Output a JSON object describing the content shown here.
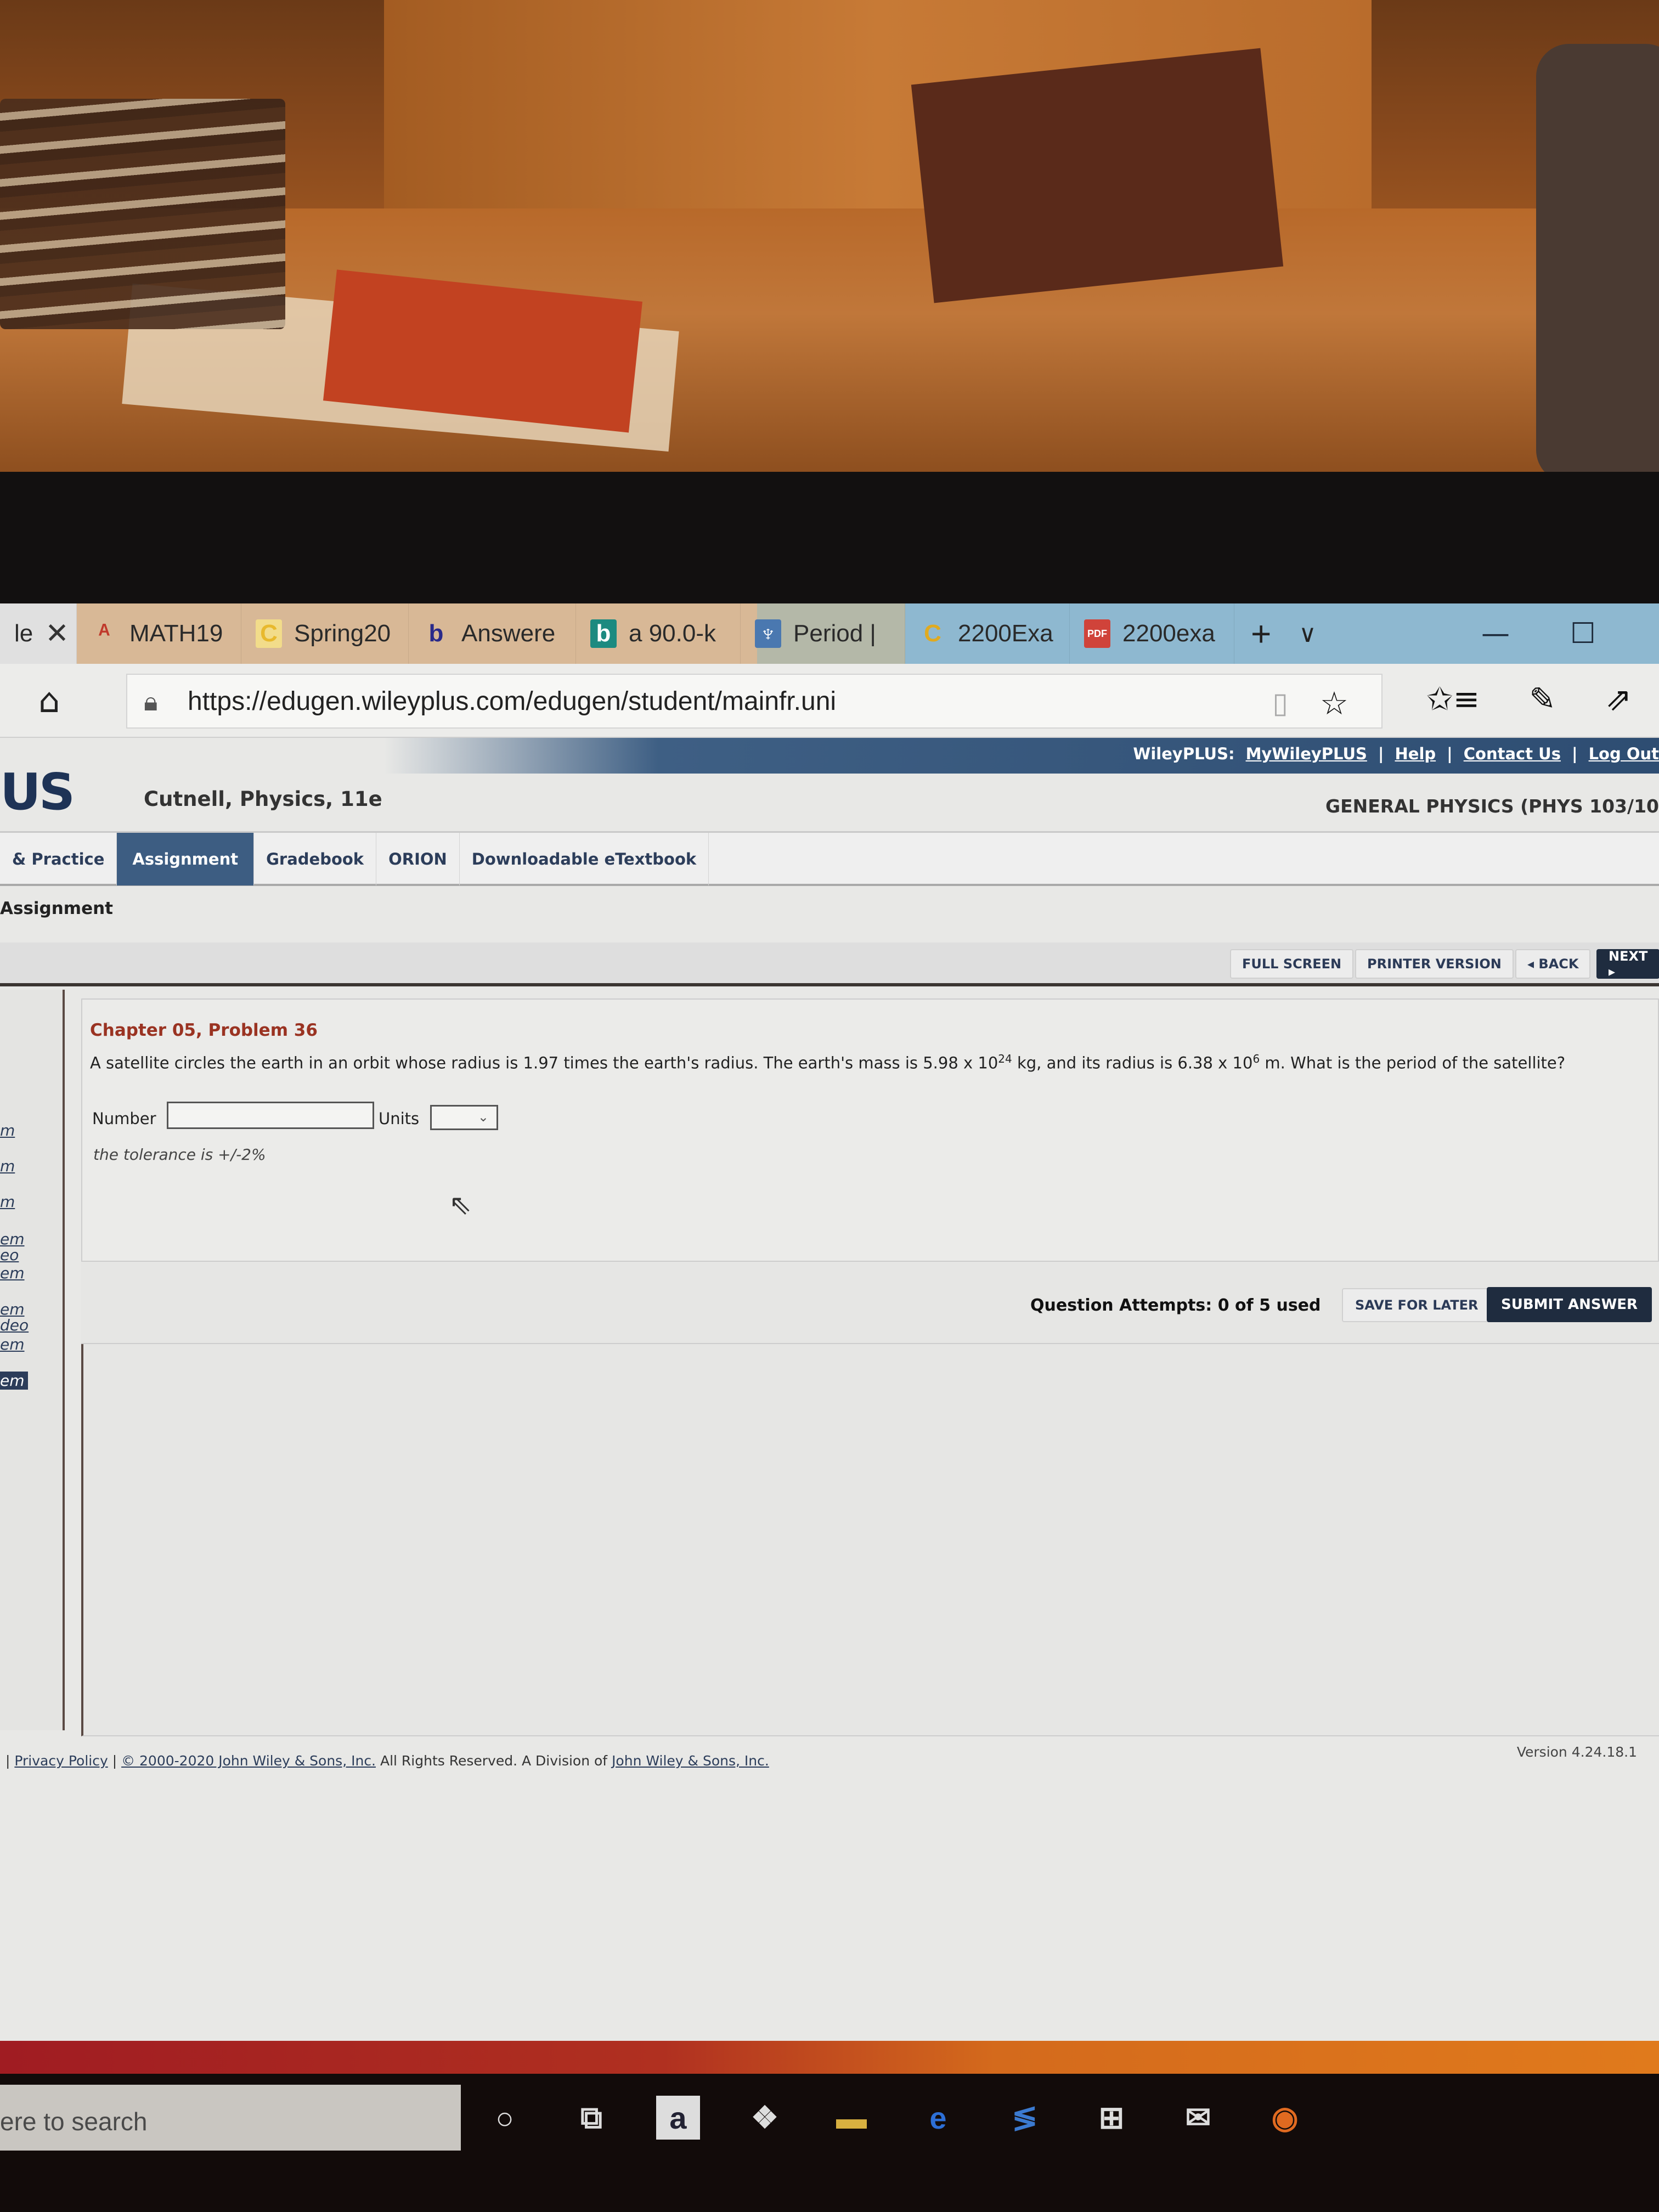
{
  "browser": {
    "tabs": [
      {
        "label": "le",
        "icon": "close-icon",
        "partial": true
      },
      {
        "label": "MATH19",
        "icon": "webassign-icon"
      },
      {
        "label": "Spring20",
        "icon": "c-logo-icon"
      },
      {
        "label": "Answere",
        "icon": "b-logo-icon"
      },
      {
        "label": "a 90.0-k",
        "icon": "bing-icon"
      },
      {
        "label": "Period |",
        "icon": "thistle-icon"
      },
      {
        "label": "2200Exa",
        "icon": "c-logo-icon"
      },
      {
        "label": "2200exa",
        "icon": "pdf-icon"
      }
    ],
    "new_tab": "+",
    "tab_list": "∨",
    "minimize": "—",
    "maximize": "☐",
    "url": "https://edugen.wileyplus.com/edugen/student/mainfr.uni"
  },
  "wiley": {
    "top_label": "WileyPLUS:",
    "top_links": [
      "MyWileyPLUS",
      "Help",
      "Contact Us",
      "Log Out"
    ],
    "logo": "US",
    "book_title": "Cutnell, Physics, 11e",
    "course_title": "GENERAL PHYSICS (PHYS 103/10",
    "nav": [
      "& Practice",
      "Assignment",
      "Gradebook",
      "ORION",
      "Downloadable eTextbook"
    ],
    "nav_active": "Assignment",
    "breadcrumb": "Assignment",
    "toolbar": {
      "full_screen": "FULL SCREEN",
      "printer": "PRINTER VERSION",
      "back": "◂ BACK",
      "next": "NEXT ▸"
    },
    "sidebar_links": [
      "m",
      "m",
      "m",
      "em",
      "eo",
      "em",
      "em",
      "deo",
      "em",
      "em"
    ]
  },
  "problem": {
    "title": "Chapter 05, Problem 36",
    "text_1": "A satellite circles the earth in an orbit whose radius is 1.97 times the earth's radius. The earth's mass is 5.98 x 10",
    "exp_1": "24",
    "text_2": " kg, and its radius is 6.38 x 10",
    "exp_2": "6",
    "text_3": " m. What is the period of the satellite?",
    "number_label": "Number",
    "number_value": "",
    "units_label": "Units",
    "units_value": "",
    "tolerance": "the tolerance is +/-2%"
  },
  "attempts": {
    "text": "Question Attempts: 0 of 5 used",
    "used": 0,
    "max": 5,
    "save_label": "SAVE FOR LATER",
    "submit_label": "SUBMIT ANSWER"
  },
  "footer": {
    "privacy": "Privacy Policy",
    "copyright": "© 2000-2020 John Wiley & Sons, Inc.",
    "rights": " All Rights Reserved. A Division of ",
    "company": "John Wiley & Sons, Inc.",
    "version": "Version 4.24.18.1"
  },
  "taskbar": {
    "search_placeholder": "ere to search",
    "icons": [
      "cortana-icon",
      "task-view-icon",
      "amazon-icon",
      "dropbox-icon",
      "file-explorer-icon",
      "edge-icon",
      "vscode-icon",
      "store-icon",
      "mail-icon",
      "firefox-icon"
    ]
  }
}
